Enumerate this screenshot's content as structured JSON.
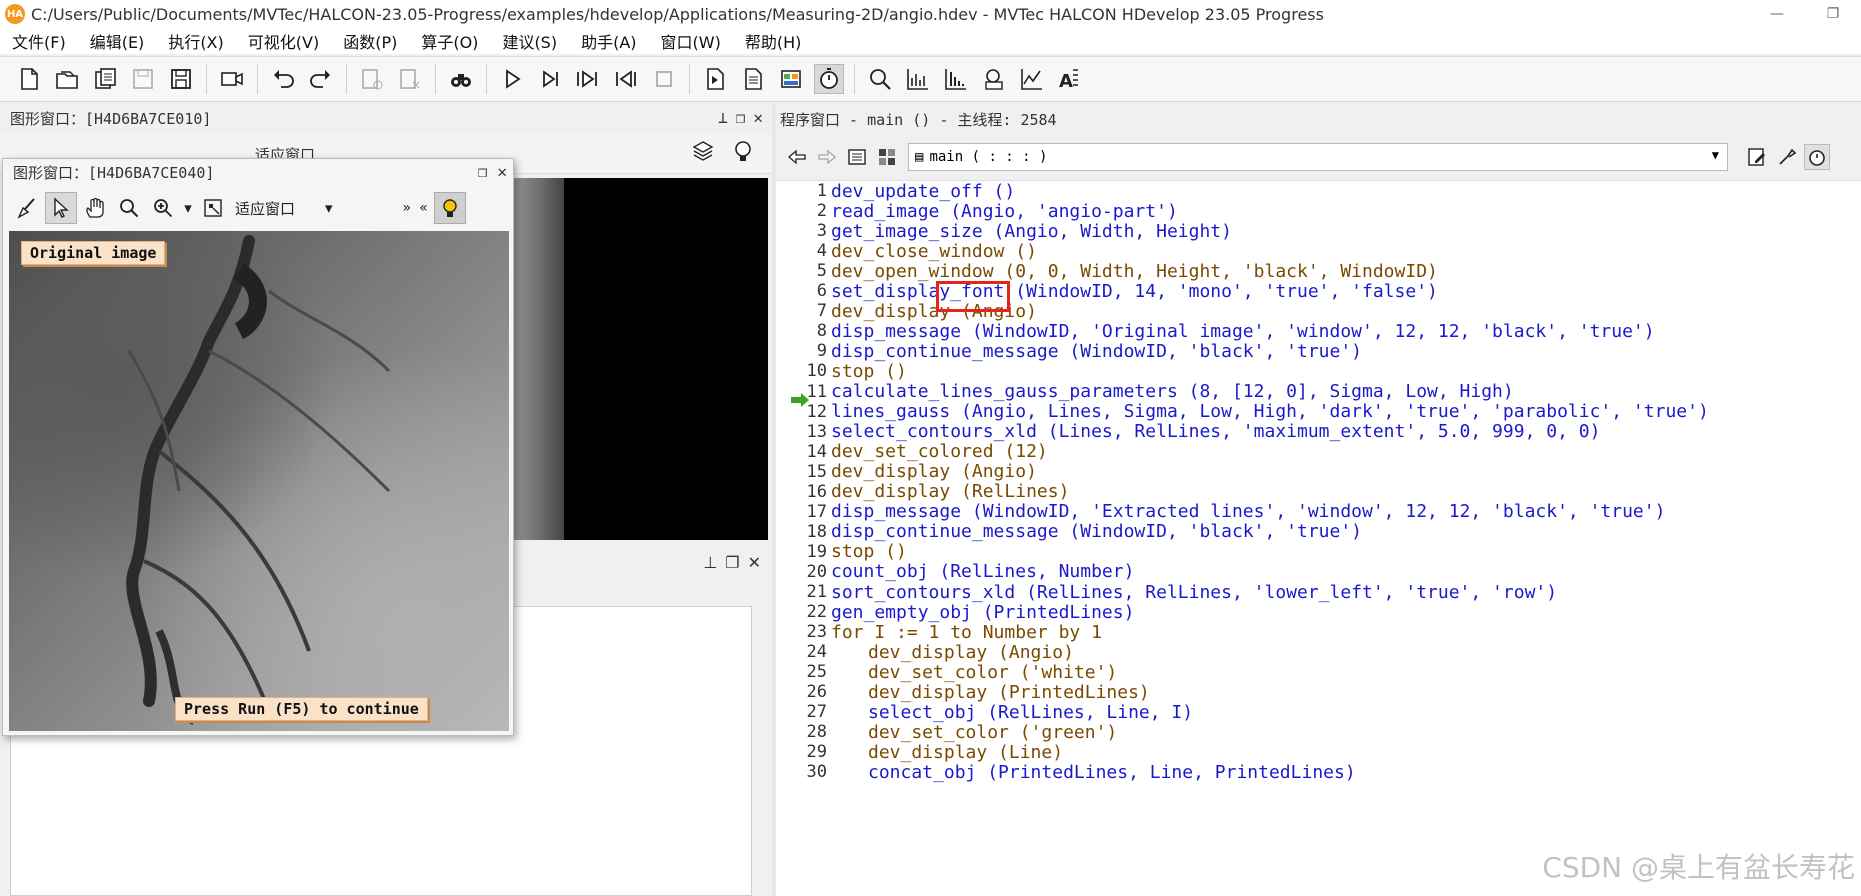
{
  "window": {
    "title": "C:/Users/Public/Documents/MVTec/HALCON-23.05-Progress/examples/hdevelop/Applications/Measuring-2D/angio.hdev - MVTec HALCON HDevelop 23.05 Progress",
    "logo": "HA"
  },
  "menu": [
    "文件(F)",
    "编辑(E)",
    "执行(X)",
    "可视化(V)",
    "函数(P)",
    "算子(O)",
    "建议(S)",
    "助手(A)",
    "窗口(W)",
    "帮助(H)"
  ],
  "graphics_panel": {
    "title": "图形窗口：[H4D6BA7CE010]",
    "toolbar_partial": "适应窗口"
  },
  "float_window": {
    "title": "图形窗口：[H4D6BA7CE040]",
    "zoom_label": "适应窗口",
    "overlay_top": "Original image",
    "overlay_bottom": "Press Run (F5) to continue"
  },
  "program": {
    "title": "程序窗口 - main () - 主线程: 2584",
    "procedure": "main ( : : : )",
    "current_line": 12,
    "lines": [
      {
        "n": "1",
        "indent": 0,
        "text": "dev_update_off ()",
        "cls": "op"
      },
      {
        "n": "2",
        "indent": 0,
        "text": "read_image (Angio, 'angio-part')",
        "cls": "op"
      },
      {
        "n": "3",
        "indent": 0,
        "text": "get_image_size (Angio, Width, Height)",
        "cls": "op"
      },
      {
        "n": "4",
        "indent": 0,
        "text": "dev_close_window ()",
        "cls": "ctl"
      },
      {
        "n": "5",
        "indent": 0,
        "text": "dev_open_window (0, 0, Width, Height, 'black', WindowID)",
        "cls": "ctl"
      },
      {
        "n": "6",
        "indent": 0,
        "text": "set_display_font (WindowID, 14, 'mono', 'true', 'false')",
        "cls": "op"
      },
      {
        "n": "7",
        "indent": 0,
        "text": "dev_display (Angio)",
        "cls": "ctl"
      },
      {
        "n": "8",
        "indent": 0,
        "text": "disp_message (WindowID, 'Original image', 'window', 12, 12, 'black', 'true')",
        "cls": "op"
      },
      {
        "n": "9",
        "indent": 0,
        "text": "disp_continue_message (WindowID, 'black', 'true')",
        "cls": "op"
      },
      {
        "n": "10",
        "indent": 0,
        "text": "stop ()",
        "cls": "ctl"
      },
      {
        "n": "11",
        "indent": 0,
        "text": "calculate_lines_gauss_parameters (8, [12, 0], Sigma, Low, High)",
        "cls": "op"
      },
      {
        "n": "12",
        "indent": 0,
        "text": "lines_gauss (Angio, Lines, Sigma, Low, High, 'dark', 'true', 'parabolic', 'true')",
        "cls": "op"
      },
      {
        "n": "13",
        "indent": 0,
        "text": "select_contours_xld (Lines, RelLines, 'maximum_extent', 5.0, 999, 0, 0)",
        "cls": "op"
      },
      {
        "n": "14",
        "indent": 0,
        "text": "dev_set_colored (12)",
        "cls": "ctl"
      },
      {
        "n": "15",
        "indent": 0,
        "text": "dev_display (Angio)",
        "cls": "ctl"
      },
      {
        "n": "16",
        "indent": 0,
        "text": "dev_display (RelLines)",
        "cls": "ctl"
      },
      {
        "n": "17",
        "indent": 0,
        "text": "disp_message (WindowID, 'Extracted lines', 'window', 12, 12, 'black', 'true')",
        "cls": "op"
      },
      {
        "n": "18",
        "indent": 0,
        "text": "disp_continue_message (WindowID, 'black', 'true')",
        "cls": "op"
      },
      {
        "n": "19",
        "indent": 0,
        "text": "stop ()",
        "cls": "ctl"
      },
      {
        "n": "20",
        "indent": 0,
        "text": "count_obj (RelLines, Number)",
        "cls": "op"
      },
      {
        "n": "21",
        "indent": 0,
        "text": "sort_contours_xld (RelLines, RelLines, 'lower_left', 'true', 'row')",
        "cls": "op"
      },
      {
        "n": "22",
        "indent": 0,
        "text": "gen_empty_obj (PrintedLines)",
        "cls": "op"
      },
      {
        "n": "23",
        "indent": 0,
        "text": "for I := 1 to Number by 1",
        "cls": "ctl"
      },
      {
        "n": "24",
        "indent": 1,
        "text": "dev_display (Angio)",
        "cls": "ctl"
      },
      {
        "n": "25",
        "indent": 1,
        "text": "dev_set_color ('white')",
        "cls": "ctl"
      },
      {
        "n": "26",
        "indent": 1,
        "text": "dev_display (PrintedLines)",
        "cls": "ctl"
      },
      {
        "n": "27",
        "indent": 1,
        "text": "select_obj (RelLines, Line, I)",
        "cls": "op"
      },
      {
        "n": "28",
        "indent": 1,
        "text": "dev_set_color ('green')",
        "cls": "ctl"
      },
      {
        "n": "29",
        "indent": 1,
        "text": "dev_display (Line)",
        "cls": "ctl"
      },
      {
        "n": "30",
        "indent": 1,
        "text": "concat_obj (PrintedLines, Line, PrintedLines)",
        "cls": "op"
      }
    ]
  },
  "watermark": "CSDN @桌上有盆长寿花",
  "colors": {
    "operator": "#1a1acc",
    "control": "#7a4a00",
    "highlight": "#e8231c",
    "pc_arrow": "#3aa61d"
  }
}
